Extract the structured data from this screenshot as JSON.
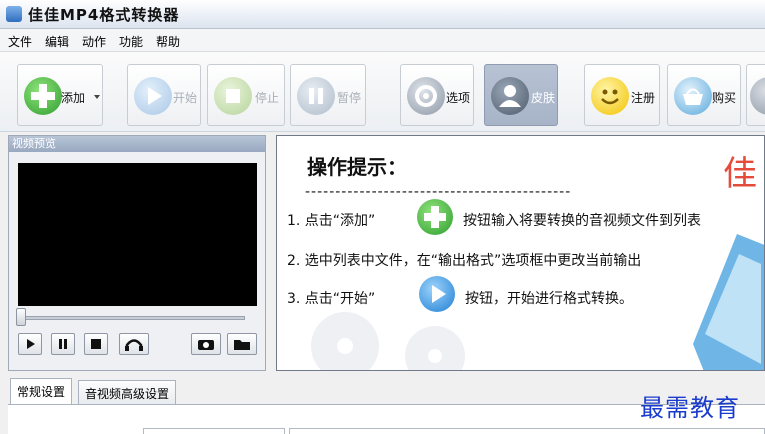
{
  "app": {
    "title": "佳佳MP4格式转换器"
  },
  "menu": [
    "文件",
    "编辑",
    "动作",
    "功能",
    "帮助"
  ],
  "toolbar": {
    "add": "添加",
    "start": "开始",
    "stop": "停止",
    "pause": "暂停",
    "options": "选项",
    "skin": "皮肤",
    "register": "注册",
    "buy": "购买"
  },
  "preview": {
    "header": "视频预览"
  },
  "tips": {
    "title": "操作提示：",
    "dashes": "--------------------------------------------",
    "line1_a": "1. 点击“添加”",
    "line1_b": "按钮输入将要转换的音视频文件到列表",
    "line2": "2. 选中列表中文件，在“输出格式”选项框中更改当前输出",
    "line3_a": "3. 点击“开始”",
    "line3_b": "按钮，开始进行格式转换。",
    "brand_char": "佳"
  },
  "tabs": [
    "常规设置",
    "音视频高级设置"
  ],
  "watermark": "最需教育",
  "colors": {
    "accent_green": "#3ab54a",
    "accent_blue": "#2d8fe0",
    "toolbar_pressed": "#a7b4c8"
  }
}
